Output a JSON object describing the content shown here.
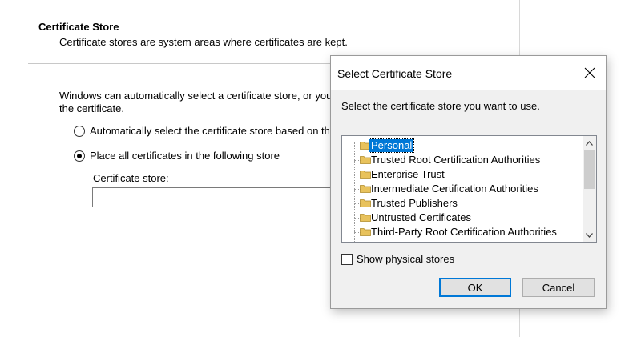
{
  "wizard": {
    "header_title": "Certificate Store",
    "header_desc": "Certificate stores are system areas where certificates are kept.",
    "intro_line1": "Windows can automatically select a certificate store, or you",
    "intro_line2": "the certificate.",
    "radio_auto_label": "Automatically select the certificate store based on the",
    "radio_place_label": "Place all certificates in the following store",
    "store_label": "Certificate store:",
    "store_value": ""
  },
  "dialog": {
    "title": "Select Certificate Store",
    "prompt": "Select the certificate store you want to use.",
    "stores": [
      {
        "label": "Personal",
        "selected": true
      },
      {
        "label": "Trusted Root Certification Authorities",
        "selected": false
      },
      {
        "label": "Enterprise Trust",
        "selected": false
      },
      {
        "label": "Intermediate Certification Authorities",
        "selected": false
      },
      {
        "label": "Trusted Publishers",
        "selected": false
      },
      {
        "label": "Untrusted Certificates",
        "selected": false
      },
      {
        "label": "Third-Party Root Certification Authorities",
        "selected": false
      }
    ],
    "show_physical_label": "Show physical stores",
    "ok_label": "OK",
    "cancel_label": "Cancel"
  },
  "colors": {
    "selection": "#0078d7",
    "folder": "#e8c25c"
  }
}
